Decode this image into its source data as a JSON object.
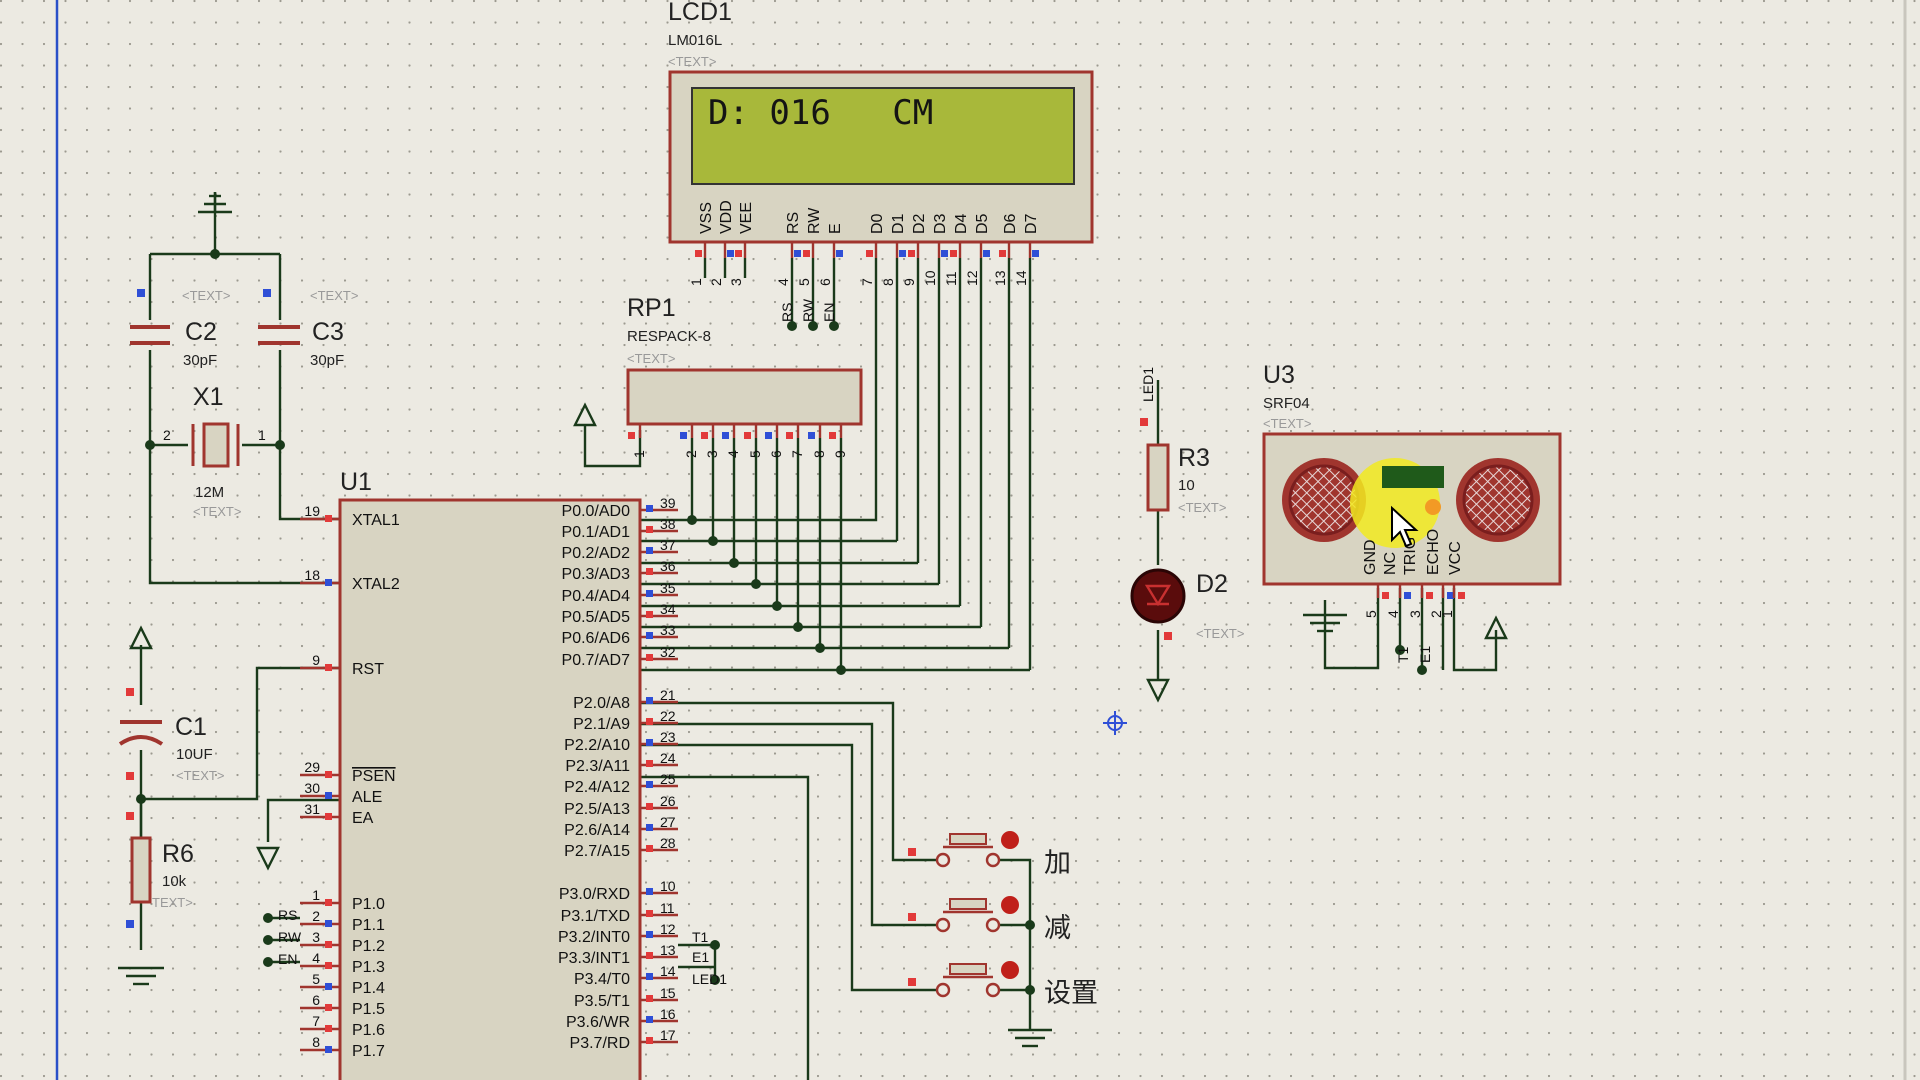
{
  "lcd": {
    "ref": "LCD1",
    "part": "LM016L",
    "text": "<TEXT>",
    "display_line1": "D: 016   CM",
    "pins": [
      "VSS",
      "VDD",
      "VEE",
      "RS",
      "RW",
      "E",
      "D0",
      "D1",
      "D2",
      "D3",
      "D4",
      "D5",
      "D6",
      "D7"
    ],
    "pin_numbers": [
      "1",
      "2",
      "3",
      "4",
      "5",
      "6",
      "7",
      "8",
      "9",
      "10",
      "11",
      "12",
      "13",
      "14"
    ],
    "net_rs": "RS",
    "net_rw": "RW",
    "net_en": "EN"
  },
  "rp1": {
    "ref": "RP1",
    "part": "RESPACK-8",
    "text": "<TEXT>",
    "pin_numbers": [
      "1",
      "2",
      "3",
      "4",
      "5",
      "6",
      "7",
      "8",
      "9"
    ]
  },
  "c2": {
    "ref": "C2",
    "value": "30pF",
    "text": "<TEXT>"
  },
  "c3": {
    "ref": "C3",
    "value": "30pF",
    "text": "<TEXT>"
  },
  "x1": {
    "ref": "X1",
    "value": "12M",
    "text": "<TEXT>",
    "pin1": "1",
    "pin2": "2"
  },
  "c1": {
    "ref": "C1",
    "value": "10UF",
    "text": "<TEXT>"
  },
  "r6": {
    "ref": "R6",
    "value": "10k",
    "text": "TEXT>"
  },
  "u1": {
    "ref": "U1",
    "left_pins": [
      {
        "num": "19",
        "name": "XTAL1"
      },
      {
        "num": "18",
        "name": "XTAL2"
      },
      {
        "num": "9",
        "name": "RST"
      },
      {
        "num": "29",
        "name": "PSEN"
      },
      {
        "num": "30",
        "name": "ALE"
      },
      {
        "num": "31",
        "name": "EA"
      },
      {
        "num": "1",
        "name": "P1.0"
      },
      {
        "num": "2",
        "name": "P1.1"
      },
      {
        "num": "3",
        "name": "P1.2"
      },
      {
        "num": "4",
        "name": "P1.3"
      },
      {
        "num": "5",
        "name": "P1.4"
      },
      {
        "num": "6",
        "name": "P1.5"
      },
      {
        "num": "7",
        "name": "P1.6"
      },
      {
        "num": "8",
        "name": "P1.7"
      }
    ],
    "right_pins": [
      {
        "num": "39",
        "name": "P0.0/AD0"
      },
      {
        "num": "38",
        "name": "P0.1/AD1"
      },
      {
        "num": "37",
        "name": "P0.2/AD2"
      },
      {
        "num": "36",
        "name": "P0.3/AD3"
      },
      {
        "num": "35",
        "name": "P0.4/AD4"
      },
      {
        "num": "34",
        "name": "P0.5/AD5"
      },
      {
        "num": "33",
        "name": "P0.6/AD6"
      },
      {
        "num": "32",
        "name": "P0.7/AD7"
      },
      {
        "num": "21",
        "name": "P2.0/A8"
      },
      {
        "num": "22",
        "name": "P2.1/A9"
      },
      {
        "num": "23",
        "name": "P2.2/A10"
      },
      {
        "num": "24",
        "name": "P2.3/A11"
      },
      {
        "num": "25",
        "name": "P2.4/A12"
      },
      {
        "num": "26",
        "name": "P2.5/A13"
      },
      {
        "num": "27",
        "name": "P2.6/A14"
      },
      {
        "num": "28",
        "name": "P2.7/A15"
      },
      {
        "num": "10",
        "name": "P3.0/RXD"
      },
      {
        "num": "11",
        "name": "P3.1/TXD"
      },
      {
        "num": "12",
        "name": "P3.2/INT0"
      },
      {
        "num": "13",
        "name": "P3.3/INT1"
      },
      {
        "num": "14",
        "name": "P3.4/T0"
      },
      {
        "num": "15",
        "name": "P3.5/T1"
      },
      {
        "num": "16",
        "name": "P3.6/WR"
      },
      {
        "num": "17",
        "name": "P3.7/RD"
      }
    ],
    "net_rs": "RS",
    "net_rw": "RW",
    "net_en": "EN",
    "net_t1": "T1",
    "net_e1": "E1",
    "net_led1": "LED1"
  },
  "r3": {
    "ref": "R3",
    "value": "10",
    "text": "<TEXT>",
    "net": "LED1"
  },
  "d2": {
    "ref": "D2",
    "text": "<TEXT>"
  },
  "u3": {
    "ref": "U3",
    "part": "SRF04",
    "text": "<TEXT>",
    "pins": [
      "GND",
      "NC",
      "TRIG",
      "ECHO",
      "VCC"
    ],
    "pin_numbers": [
      "5",
      "4",
      "3",
      "2",
      "1"
    ],
    "net_t1": "T1",
    "net_e1": "E1"
  },
  "buttons": {
    "add": "加",
    "sub": "减",
    "set": "设置"
  },
  "colors": {
    "sheet": "#eceae2",
    "component_border": "#a0352e",
    "component_fill": "#d8d4c2",
    "wire": "#1a3a1a",
    "lcd_screen": "#a8b83a",
    "pin_red": "#e23a3a",
    "pin_blue": "#2f4fd6"
  }
}
